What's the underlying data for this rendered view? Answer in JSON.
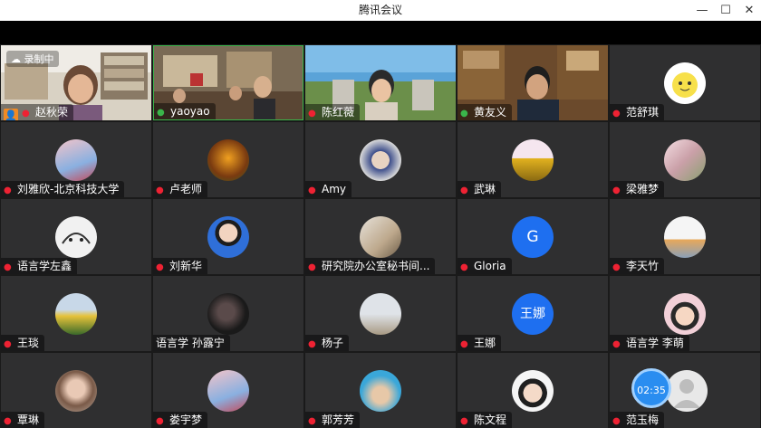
{
  "window": {
    "title": "腾讯会议"
  },
  "recording": {
    "label": "录制中"
  },
  "participants": [
    {
      "name": "赵秋荣",
      "mic": "off",
      "video": true
    },
    {
      "name": "yaoyao",
      "mic": "on",
      "video": true
    },
    {
      "name": "陈红薇",
      "mic": "none",
      "video": true
    },
    {
      "name": "黄友义",
      "mic": "on",
      "video": true
    },
    {
      "name": "范舒琪",
      "mic": "off",
      "video": false
    },
    {
      "name": "刘雅欣-北京科技大学",
      "mic": "off",
      "video": false
    },
    {
      "name": "卢老师",
      "mic": "off",
      "video": false
    },
    {
      "name": "Amy",
      "mic": "off",
      "video": false
    },
    {
      "name": "武琳",
      "mic": "off",
      "video": false
    },
    {
      "name": "梁雅梦",
      "mic": "off",
      "video": false
    },
    {
      "name": "语言学左鑫",
      "mic": "off",
      "video": false
    },
    {
      "name": "刘新华",
      "mic": "off",
      "video": false
    },
    {
      "name": "研究院办公室秘书间...",
      "mic": "off",
      "video": false
    },
    {
      "name": "Gloria",
      "mic": "off",
      "video": false,
      "avatar_letter": "G"
    },
    {
      "name": "李天竹",
      "mic": "off",
      "video": false
    },
    {
      "name": "王琰",
      "mic": "off",
      "video": false
    },
    {
      "name": "语言学 孙露宁",
      "mic": "none",
      "video": false
    },
    {
      "name": "杨子",
      "mic": "off",
      "video": false
    },
    {
      "name": "王娜",
      "mic": "off",
      "video": false,
      "avatar_text": "王娜"
    },
    {
      "name": "语言学 李萌",
      "mic": "off",
      "video": false
    },
    {
      "name": "覃琳",
      "mic": "off",
      "video": false
    },
    {
      "name": "娄宇梦",
      "mic": "off",
      "video": false
    },
    {
      "name": "郭芳芳",
      "mic": "off",
      "video": false
    },
    {
      "name": "陈文程",
      "mic": "off",
      "video": false
    },
    {
      "name": "范玉梅",
      "mic": "off",
      "video": false,
      "timer": "02:35"
    }
  ]
}
